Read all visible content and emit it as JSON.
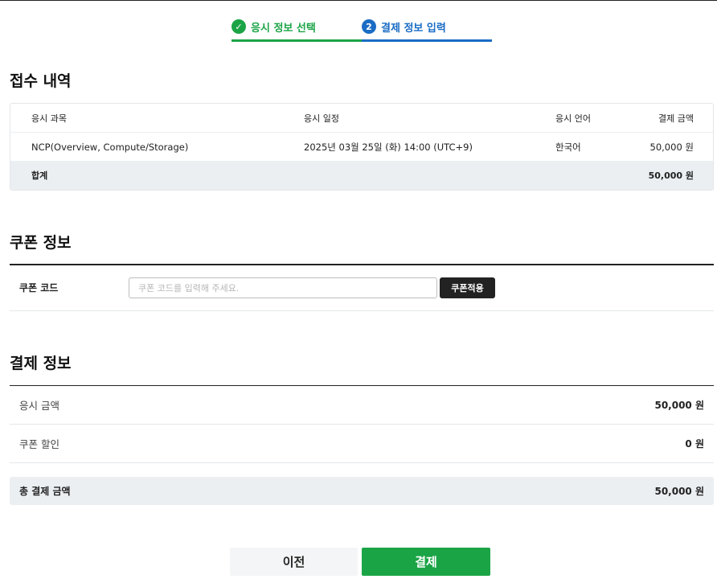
{
  "stepper": {
    "steps": [
      {
        "number": "✓",
        "label": "응시 정보 선택",
        "state": "done",
        "color": "#1ba446"
      },
      {
        "number": "2",
        "label": "결제 정보 입력",
        "state": "active",
        "color": "#1a6cc4"
      }
    ]
  },
  "reception": {
    "title": "접수 내역",
    "columns": [
      "응시 과목",
      "응시 일정",
      "응시 언어",
      "결제 금액"
    ],
    "rows": [
      {
        "subject": "NCP(Overview, Compute/Storage)",
        "schedule": "2025년 03월 25일 (화) 14:00 (UTC+9)",
        "language": "한국어",
        "amount": "50,000 원"
      }
    ],
    "total_label": "합계",
    "total_amount": "50,000 원"
  },
  "coupon": {
    "title": "쿠폰 정보",
    "label": "쿠폰 코드",
    "input_value": "",
    "placeholder": "쿠폰 코드를 입력해 주세요.",
    "apply_label": "쿠폰적용"
  },
  "payment": {
    "title": "결제 정보",
    "exam_amount_label": "응시 금액",
    "exam_amount": "50,000 원",
    "discount_label": "쿠폰 할인",
    "discount": "0 원",
    "total_label": "총 결제 금액",
    "total": "50,000 원"
  },
  "actions": {
    "prev_label": "이전",
    "pay_label": "결제"
  },
  "colors": {
    "accent_green": "#1ba446",
    "accent_blue": "#1a6cc4",
    "summary_bg": "#ebeff2"
  }
}
